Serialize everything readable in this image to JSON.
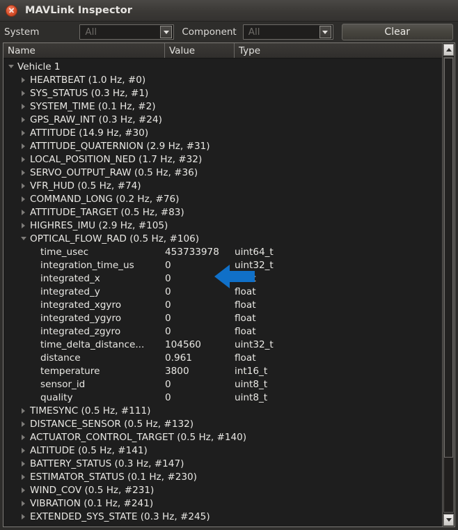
{
  "window": {
    "title": "MAVLink Inspector",
    "close_icon": "close-icon"
  },
  "toolbar": {
    "system_label": "System",
    "system_value": "All",
    "component_label": "Component",
    "component_value": "All",
    "clear_label": "Clear",
    "dropdown_icon": "chevron-down-icon"
  },
  "table": {
    "columns": [
      "Name",
      "Value",
      "Type"
    ]
  },
  "annotation": {
    "arrow_color": "#1070c8",
    "points_to": "OPTICAL_FLOW_RAD (0.5 Hz, #106)"
  },
  "scrollbar": {
    "up_icon": "scroll-up-icon",
    "down_icon": "scroll-down-icon"
  },
  "tree": {
    "root": "Vehicle 1",
    "messages_top": [
      "HEARTBEAT (1.0 Hz, #0)",
      "SYS_STATUS (0.3 Hz, #1)",
      "SYSTEM_TIME (0.1 Hz, #2)",
      "GPS_RAW_INT (0.3 Hz, #24)",
      "ATTITUDE (14.9 Hz, #30)",
      "ATTITUDE_QUATERNION (2.9 Hz, #31)",
      "LOCAL_POSITION_NED (1.7 Hz, #32)",
      "SERVO_OUTPUT_RAW (0.5 Hz, #36)",
      "VFR_HUD (0.5 Hz, #74)",
      "COMMAND_LONG (0.2 Hz, #76)",
      "ATTITUDE_TARGET (0.5 Hz, #83)",
      "HIGHRES_IMU (2.9 Hz, #105)"
    ],
    "expanded_message": "OPTICAL_FLOW_RAD (0.5 Hz, #106)",
    "fields": [
      {
        "name": "time_usec",
        "value": "453733978",
        "type": "uint64_t"
      },
      {
        "name": "integration_time_us",
        "value": "0",
        "type": "uint32_t"
      },
      {
        "name": "integrated_x",
        "value": "0",
        "type": "float"
      },
      {
        "name": "integrated_y",
        "value": "0",
        "type": "float"
      },
      {
        "name": "integrated_xgyro",
        "value": "0",
        "type": "float"
      },
      {
        "name": "integrated_ygyro",
        "value": "0",
        "type": "float"
      },
      {
        "name": "integrated_zgyro",
        "value": "0",
        "type": "float"
      },
      {
        "name": "time_delta_distance...",
        "value": "104560",
        "type": "uint32_t"
      },
      {
        "name": "distance",
        "value": "0.961",
        "type": "float"
      },
      {
        "name": "temperature",
        "value": "3800",
        "type": "int16_t"
      },
      {
        "name": "sensor_id",
        "value": "0",
        "type": "uint8_t"
      },
      {
        "name": "quality",
        "value": "0",
        "type": "uint8_t"
      }
    ],
    "messages_bottom": [
      "TIMESYNC (0.5 Hz, #111)",
      "DISTANCE_SENSOR (0.5 Hz, #132)",
      "ACTUATOR_CONTROL_TARGET (0.5 Hz, #140)",
      "ALTITUDE (0.5 Hz, #141)",
      "BATTERY_STATUS (0.3 Hz, #147)",
      "ESTIMATOR_STATUS (0.1 Hz, #230)",
      "WIND_COV (0.5 Hz, #231)",
      "VIBRATION (0.1 Hz, #241)",
      "EXTENDED_SYS_STATE (0.3 Hz, #245)"
    ]
  }
}
